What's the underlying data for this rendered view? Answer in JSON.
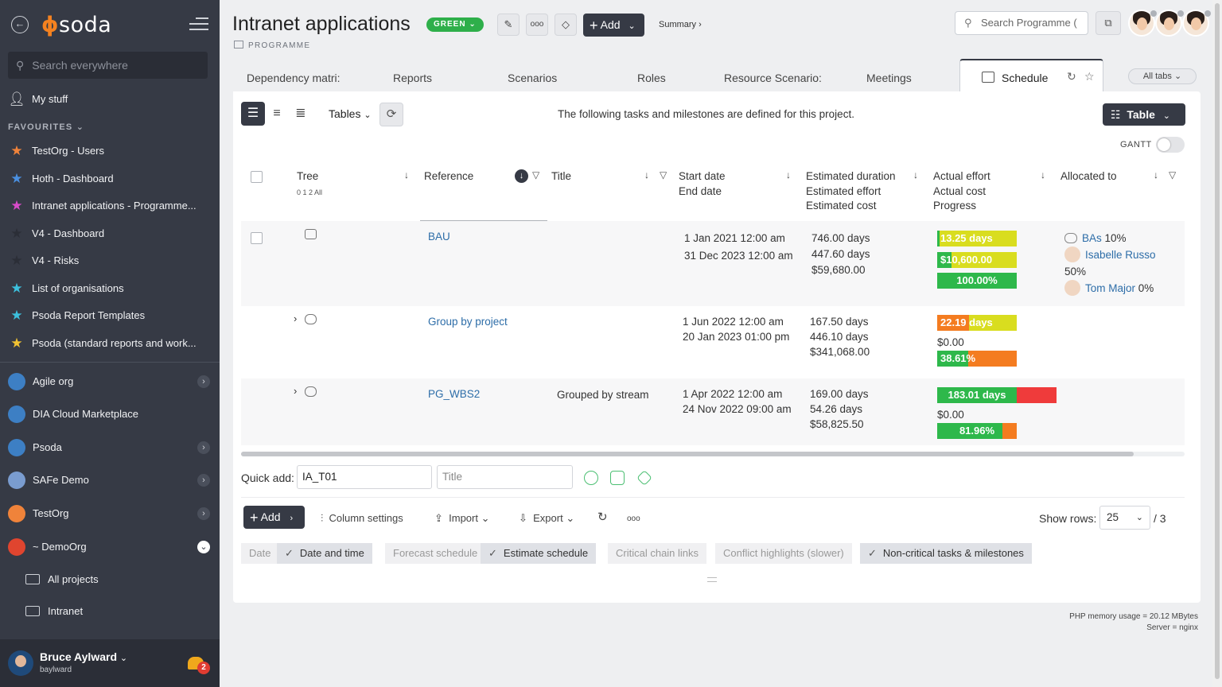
{
  "sidebar": {
    "search_placeholder": "Search everywhere",
    "my_stuff": "My stuff",
    "favourites_label": "FAVOURITES",
    "favourites": [
      {
        "label": "TestOrg - Users",
        "color": "#f0833a"
      },
      {
        "label": "Hoth - Dashboard",
        "color": "#4a8fe0"
      },
      {
        "label": "Intranet applications - Programme...",
        "color": "#d84bc9"
      },
      {
        "label": "V4 - Dashboard",
        "color": "#2b2e37"
      },
      {
        "label": "V4 - Risks",
        "color": "#2b2e37"
      },
      {
        "label": "List of organisations",
        "color": "#3cc0dd"
      },
      {
        "label": "Psoda Report Templates",
        "color": "#3cc0dd"
      },
      {
        "label": "Psoda (standard reports and work...",
        "color": "#f1c232"
      }
    ],
    "orgs": [
      {
        "label": "Agile org",
        "color": "#3d7fc4"
      },
      {
        "label": "DIA Cloud Marketplace",
        "color": "#3d7fc4"
      },
      {
        "label": "Psoda",
        "color": "#3d7fc4"
      },
      {
        "label": "SAFe Demo",
        "color": "#7a9ccf"
      },
      {
        "label": "TestOrg",
        "color": "#f0833a"
      },
      {
        "label": "~ DemoOrg",
        "color": "#e0452f"
      }
    ],
    "subs": [
      "All projects",
      "Intranet"
    ],
    "user_name": "Bruce Aylward",
    "user_login": "baylward",
    "notifications": "2"
  },
  "header": {
    "title": "Intranet applications",
    "status": "GREEN",
    "type": "PROGRAMME",
    "add_label": "Add",
    "summary_link": "Summary ›",
    "search_placeholder": "Search Programme (",
    "more_icon": "ooo"
  },
  "tabs": [
    "Dependency matri:",
    "Reports",
    "Scenarios",
    "Roles",
    "Resource Scenario:",
    "Meetings"
  ],
  "active_tab": "Schedule",
  "all_tabs": "All tabs",
  "panel": {
    "tables_label": "Tables",
    "message": "The following tasks and milestones are defined for this project.",
    "table_label": "Table",
    "gantt_label": "GANTT"
  },
  "columns": {
    "tree": "Tree",
    "tree_levels": "0 1 2 All",
    "reference": "Reference",
    "title": "Title",
    "dates": [
      "Start date",
      "End date"
    ],
    "estimates": [
      "Estimated duration",
      "Estimated effort",
      "Estimated cost"
    ],
    "actuals": [
      "Actual effort",
      "Actual cost",
      "Progress"
    ],
    "allocated": "Allocated to"
  },
  "rows": [
    {
      "reference": "BAU",
      "title": "",
      "start": "1 Jan 2021 12:00 am",
      "end": "31 Dec 2023 12:00 am",
      "est_duration": "746.00 days",
      "est_effort": "447.60 days",
      "est_cost": "$59,680.00",
      "effort_label": "13.25 days",
      "effort_pct": 2.96,
      "effort_fill": "#2eb84b",
      "effort_track": "#d9dd1f",
      "cost_label": "$10,600.00",
      "cost_pct": 17.8,
      "cost_fill": "#2eb84b",
      "cost_track": "#d9dd1f",
      "progress_label": "100.00%",
      "progress_pct": 100,
      "progress_fill": "#2eb84b",
      "progress_track": "#2eb84b",
      "alloc_group": "BAs",
      "alloc_group_pct": "10%",
      "alloc": [
        {
          "name": "Isabelle Russo",
          "pct": "50%"
        },
        {
          "name": "Tom Major",
          "pct": "0%"
        }
      ]
    },
    {
      "reference": "Group by project",
      "title": "",
      "start": "1 Jun 2022 12:00 am",
      "end": "20 Jan 2023 01:00 pm",
      "est_duration": "167.50 days",
      "est_effort": "446.10 days",
      "est_cost": "$341,068.00",
      "effort_label": "22.19 days",
      "effort_pct": 40,
      "effort_fill": "#f47c20",
      "effort_track": "#d9dd1f",
      "cost_text": "$0.00",
      "progress_label": "38.61%",
      "progress_pct": 38.61,
      "progress_fill": "#2eb84b",
      "progress_track": "#f47c20"
    },
    {
      "reference": "PG_WBS2",
      "title": "Grouped by stream",
      "start": "1 Apr 2022 12:00 am",
      "end": "24 Nov 2022 09:00 am",
      "est_duration": "169.00 days",
      "est_effort": "54.26 days",
      "est_cost": "$58,825.50",
      "effort_label": "183.01 days",
      "effort_pct": 66.7,
      "effort_fill": "#2eb84b",
      "effort_track": "#ef3b3b",
      "cost_text": "$0.00",
      "progress_label": "81.96%",
      "progress_pct": 81.96,
      "progress_fill": "#2eb84b",
      "progress_track": "#f47c20"
    }
  ],
  "quick_add": {
    "label": "Quick add:",
    "ref_value": "IA_T01",
    "title_placeholder": "Title"
  },
  "toolbar": {
    "add": "Add",
    "column_settings": "Column settings",
    "import": "Import",
    "export": "Export",
    "more": "ooo",
    "show_rows_label": "Show rows:",
    "show_rows_value": "25",
    "pages": "/ 3"
  },
  "filters": [
    {
      "label": "Date",
      "on": false
    },
    {
      "label": "Date and time",
      "on": true
    },
    {
      "label": "Forecast schedule",
      "on": false
    },
    {
      "label": "Estimate schedule",
      "on": true
    },
    {
      "label": "Critical chain links",
      "on": false
    },
    {
      "label": "Conflict highlights (slower)",
      "on": false
    },
    {
      "label": "Non-critical tasks & milestones",
      "on": true
    }
  ],
  "footer": {
    "memory": "PHP memory usage = 20.12 MBytes",
    "server": "Server = nginx"
  }
}
